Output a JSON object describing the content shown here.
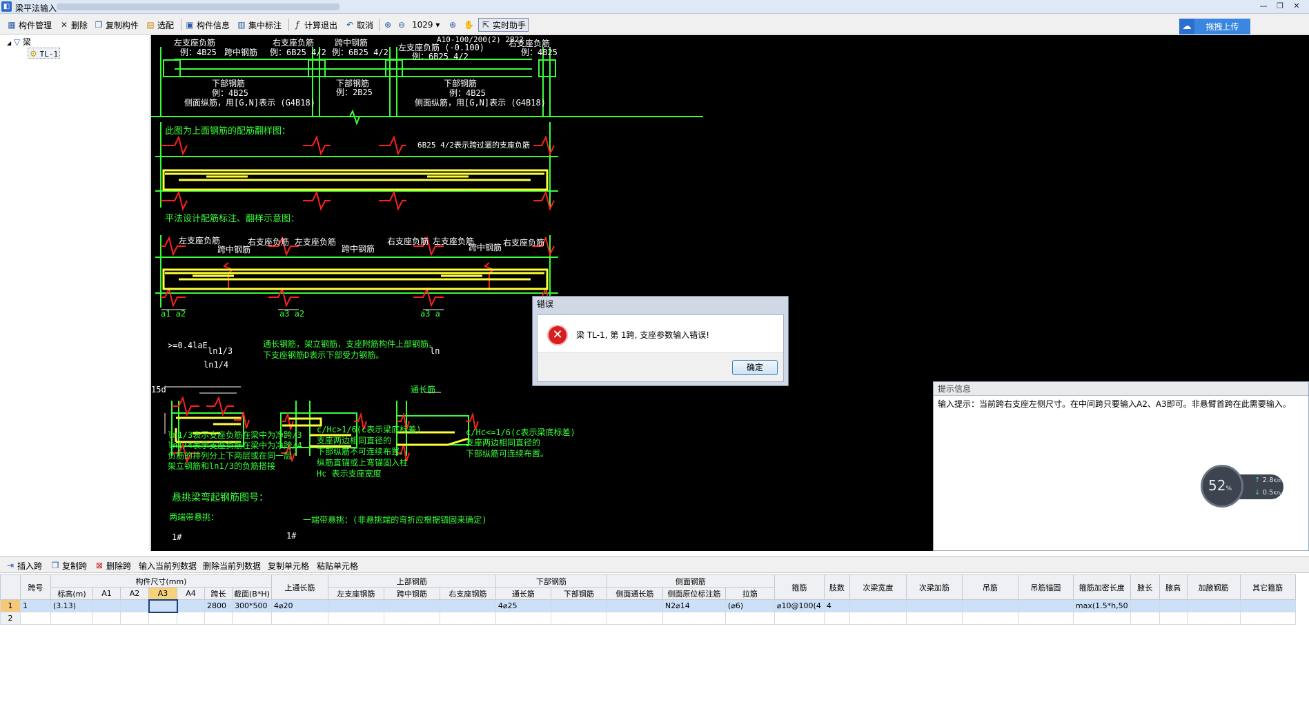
{
  "window": {
    "title": "梁平法输入",
    "controls": [
      "—",
      "❐",
      "✕"
    ]
  },
  "toolbar": {
    "component_manage": "构件管理",
    "delete": "删除",
    "copy_component": "复制构件",
    "select_config": "选配",
    "component_info": "构件信息",
    "concentrated_mark": "集中标注",
    "calc_exit": "计算退出",
    "cancel": "取消",
    "zoom_value": "1029",
    "realtime_helper": "实时助手",
    "upload": "拖拽上传"
  },
  "tree": {
    "root": "梁",
    "child": "TL-1"
  },
  "cad": {
    "t1": "左支座负筋",
    "t1b": "例：4B25",
    "t2": "跨中钢筋",
    "t3": "右支座负筋",
    "t3b": "例：6B25 4/2",
    "t4": "跨中钢筋",
    "t4b": "例：6B25 4/2",
    "t5a": "A10-100/200(2) 2B22",
    "t5": "左支座负筋 (-0.100)",
    "t5b": "例：6B25 4/2",
    "t6": "右支座负筋",
    "t6b": "例：4B25",
    "b1": "下部钢筋",
    "b1b": "例：4B25",
    "b1c": "侧面纵筋，用[G,N]表示 (G4B18)",
    "b2": "下部钢筋",
    "b2b": "例：2B25",
    "b3": "下部钢筋",
    "b3b": "例：4B25",
    "b3c": "侧面纵筋，用[G,N]表示 (G4B18)",
    "h1": "此图为上面钢筋的配筋翻样图：",
    "note1": "6B25 4/2表示跨过遛的支座负筋",
    "h2": "平法设计配筋标注、翻样示意图：",
    "s1": "左支座负筋",
    "s2": "跨中钢筋",
    "s3": "右支座负筋",
    "s4": "左支座负筋",
    "s5": "跨中钢筋",
    "s6": "右支座负筋",
    "s7": "左支座负筋",
    "s8": "跨中钢筋",
    "s9": "右支座负筋",
    "a1": "a1  a2",
    "a2": "a3  a2",
    "a3": "a3  a",
    "d1": ">=0.4laE",
    "d2": "ln1/3",
    "d3": "ln1/4",
    "d4": "15d",
    "m1": "通长钢筋，架立钢筋，支座附筋构件上部钢筋。",
    "m2": "下支座钢筋D表示下部受力钢筋。",
    "m3": "ln",
    "m4": "通长筋",
    "l1": "ln1/3表示支座负筋在梁中为净跨/3",
    "l2": "ln1/4表示支座负筋在梁中为净跨/4",
    "l3": "负筋的排列分上下两层或在同一层",
    "l4": "架立钢筋和ln1/3的负筋搭接",
    "c1": "c/Hc>1/6(c表示梁底标差)",
    "c2": "支座两边相同直径的",
    "c3": "下部纵筋不可连续布置。",
    "c4": "纵筋直锚或上弯锚固入柱",
    "c5": "Hc 表示支座宽度",
    "r1": "c/Hc<=1/6(c表示梁底标差)",
    "r2": "支座两边相同直径的",
    "r3": "下部纵筋可连续布置。",
    "k1": "悬挑梁弯起钢筋图号：",
    "k2": "两端带悬挑：",
    "k3": "一端带悬挑：(非悬挑端的弯折应根据锚固来确定)",
    "k4": "1#",
    "k5": "1#"
  },
  "hint": {
    "title": "提示信息",
    "text": "输入提示：当前跨右支座左侧尺寸。在中间跨只要输入A2、A3即可。非悬臂首跨在此需要输入。"
  },
  "speed": {
    "percent": "52",
    "unit": "%",
    "up": "2.8",
    "down": "0.5",
    "rate_unit": "K/s"
  },
  "dialog": {
    "title": "错误",
    "message": "梁 TL-1, 第 1跨, 支座参数输入错误!",
    "ok": "确定"
  },
  "toolbar2": {
    "insert_span": "插入跨",
    "copy_span": "复制跨",
    "delete_span": "删除跨",
    "input_col": "输入当前列数据",
    "delete_col": "删除当前列数据",
    "copy_cell": "复制单元格",
    "paste_cell": "粘贴单元格"
  },
  "grid": {
    "groups": {
      "size": "构件尺寸(mm)",
      "top": "上部钢筋",
      "bottom": "下部钢筋",
      "side": "侧面钢筋"
    },
    "headers": {
      "span_no": "跨号",
      "elev": "标高(m)",
      "a1": "A1",
      "a2": "A2",
      "a3": "A3",
      "a4": "A4",
      "span_len": "跨长",
      "section": "截面(B*H)",
      "top_through": "上通长筋",
      "left_support": "左支座钢筋",
      "mid_span": "跨中钢筋",
      "right_support": "右支座钢筋",
      "through": "通长筋",
      "bottom_bar": "下部钢筋",
      "side_through": "侧面通长筋",
      "side_origin": "侧面原位标注筋",
      "tie": "拉筋",
      "stirrup": "箍筋",
      "legs": "肢数",
      "sec_width": "次梁宽度",
      "sec_add": "次梁加筋",
      "hanger": "吊筋",
      "hanger_anchor": "吊筋锚固",
      "dense_len": "箍筋加密长度",
      "haunch_len": "腋长",
      "haunch_h": "腋高",
      "add_bar": "加腋钢筋",
      "other_stirrup": "其它箍筋"
    },
    "rows": [
      {
        "rownum": "1",
        "span_no": "1",
        "elev": "(3.13)",
        "a1": "",
        "a2": "",
        "a3": "",
        "a4": "",
        "span_len": "2800",
        "section": "300*500",
        "top_through": "4⌀20",
        "left_support": "",
        "mid_span": "",
        "right_support": "",
        "through": "4⌀25",
        "bottom_bar": "",
        "side_through": "",
        "side_origin": "N2⌀14",
        "tie": "(⌀6)",
        "stirrup": "⌀10@100(4",
        "legs": "4",
        "sec_width": "",
        "sec_add": "",
        "hanger": "",
        "hanger_anchor": "",
        "dense_len": "max(1.5*h,50",
        "haunch_len": "",
        "haunch_h": "",
        "add_bar": "",
        "other_stirrup": ""
      },
      {
        "rownum": "2",
        "span_no": "",
        "elev": "",
        "a1": "",
        "a2": "",
        "a3": "",
        "a4": "",
        "span_len": "",
        "section": "",
        "top_through": "",
        "left_support": "",
        "mid_span": "",
        "right_support": "",
        "through": "",
        "bottom_bar": "",
        "side_through": "",
        "side_origin": "",
        "tie": "",
        "stirrup": "",
        "legs": "",
        "sec_width": "",
        "sec_add": "",
        "hanger": "",
        "hanger_anchor": "",
        "dense_len": "",
        "haunch_len": "",
        "haunch_h": "",
        "add_bar": "",
        "other_stirrup": ""
      }
    ]
  }
}
